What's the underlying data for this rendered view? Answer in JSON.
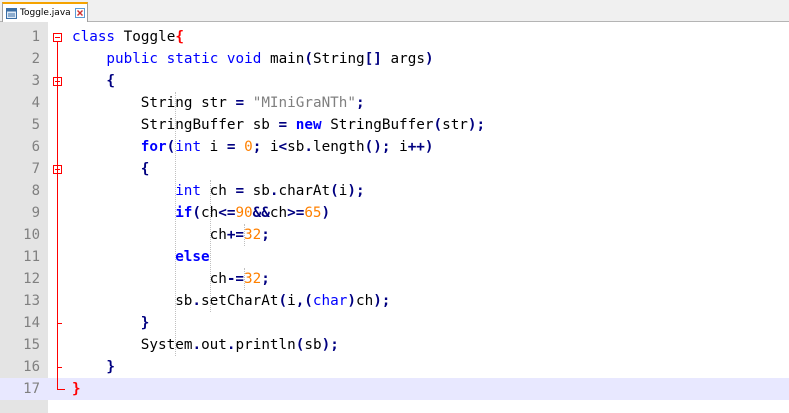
{
  "tab": {
    "filename": "Toggle.java",
    "icon": "file-icon",
    "close_icon": "close-icon"
  },
  "editor": {
    "current_line": 17,
    "lines": [
      {
        "number": "1",
        "text": "class Toggle{"
      },
      {
        "number": "2",
        "text": "public static void main(String[] args)"
      },
      {
        "number": "3",
        "text": "{"
      },
      {
        "number": "4",
        "text": "String str = \"MIniGraNTh\";"
      },
      {
        "number": "5",
        "text": "StringBuffer sb = new StringBuffer(str);"
      },
      {
        "number": "6",
        "text": "for(int i = 0; i<sb.length(); i++)"
      },
      {
        "number": "7",
        "text": "{"
      },
      {
        "number": "8",
        "text": "int ch = sb.charAt(i);"
      },
      {
        "number": "9",
        "text": "if(ch<=90&&ch>=65)"
      },
      {
        "number": "10",
        "text": "ch+=32;"
      },
      {
        "number": "11",
        "text": "else"
      },
      {
        "number": "12",
        "text": "ch-=32;"
      },
      {
        "number": "13",
        "text": "sb.setCharAt(i,(char)ch);"
      },
      {
        "number": "14",
        "text": "}"
      },
      {
        "number": "15",
        "text": "System.out.println(sb);"
      },
      {
        "number": "16",
        "text": "}"
      },
      {
        "number": "17",
        "text": "}"
      }
    ]
  },
  "colors": {
    "keyword": "#0000ff",
    "operator": "#000080",
    "string": "#808080",
    "number": "#ff8000",
    "fold_marker": "#ff0000",
    "current_line": "#e8e8ff",
    "gutter": "#e4e4e4"
  }
}
